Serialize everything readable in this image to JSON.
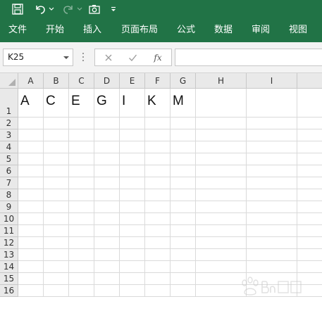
{
  "qat": {
    "icons": [
      "save-icon",
      "undo-icon",
      "redo-icon",
      "camera-icon",
      "customize-qat-icon"
    ]
  },
  "ribbon": {
    "tabs": [
      {
        "label": "文件"
      },
      {
        "label": "开始"
      },
      {
        "label": "插入"
      },
      {
        "label": "页面布局"
      },
      {
        "label": "公式"
      },
      {
        "label": "数据"
      },
      {
        "label": "审阅"
      },
      {
        "label": "视图"
      }
    ]
  },
  "formula_bar": {
    "name_box": "K25",
    "fx_label": "fx",
    "value": ""
  },
  "sheet": {
    "columns": [
      "A",
      "B",
      "C",
      "D",
      "E",
      "F",
      "G",
      "H",
      "I"
    ],
    "rows": [
      "1",
      "2",
      "3",
      "4",
      "5",
      "6",
      "7",
      "8",
      "9",
      "10",
      "11",
      "12",
      "13",
      "14",
      "15",
      "16"
    ],
    "cells": {
      "A1": "A",
      "B1": "C",
      "C1": "E",
      "D1": "G",
      "E1": "I",
      "F1": "K",
      "G1": "M"
    }
  },
  "colors": {
    "ribbon_green": "#217346"
  }
}
